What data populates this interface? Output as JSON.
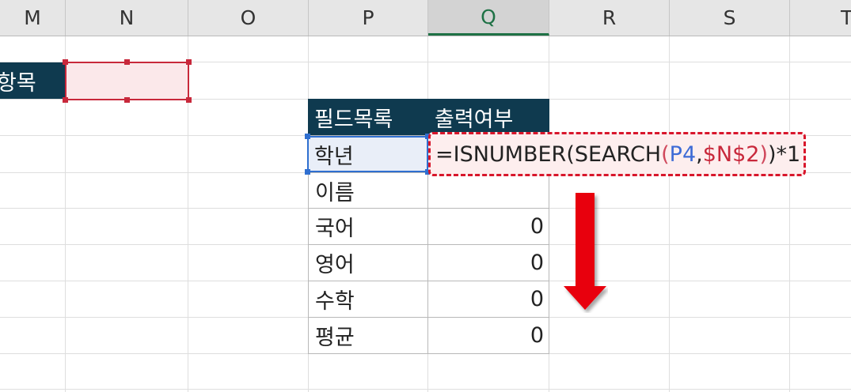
{
  "columns": [
    "M",
    "N",
    "O",
    "P",
    "Q",
    "R",
    "S",
    "T"
  ],
  "active_column": "Q",
  "criteria_header": "항목",
  "table": {
    "headers": [
      "필드목록",
      "출력여부"
    ],
    "rows": [
      {
        "field": "학년",
        "value": ""
      },
      {
        "field": "이름",
        "value": ""
      },
      {
        "field": "국어",
        "value": "0"
      },
      {
        "field": "영어",
        "value": "0"
      },
      {
        "field": "수학",
        "value": "0"
      },
      {
        "field": "평균",
        "value": "0"
      }
    ]
  },
  "formula": {
    "eq": "=ISNUMBER(SEARCH",
    "open": "(",
    "ref1": "P4",
    "comma": ",",
    "ref2": "$N$2",
    "close": ")",
    "tail": ")*1"
  },
  "colors": {
    "header_fill": "#0f3a4f",
    "highlight_red": "#d8162b",
    "ref_blue": "#3d6bd6",
    "arrow": "#e8000b"
  },
  "icons": [
    "down-arrow-icon"
  ]
}
